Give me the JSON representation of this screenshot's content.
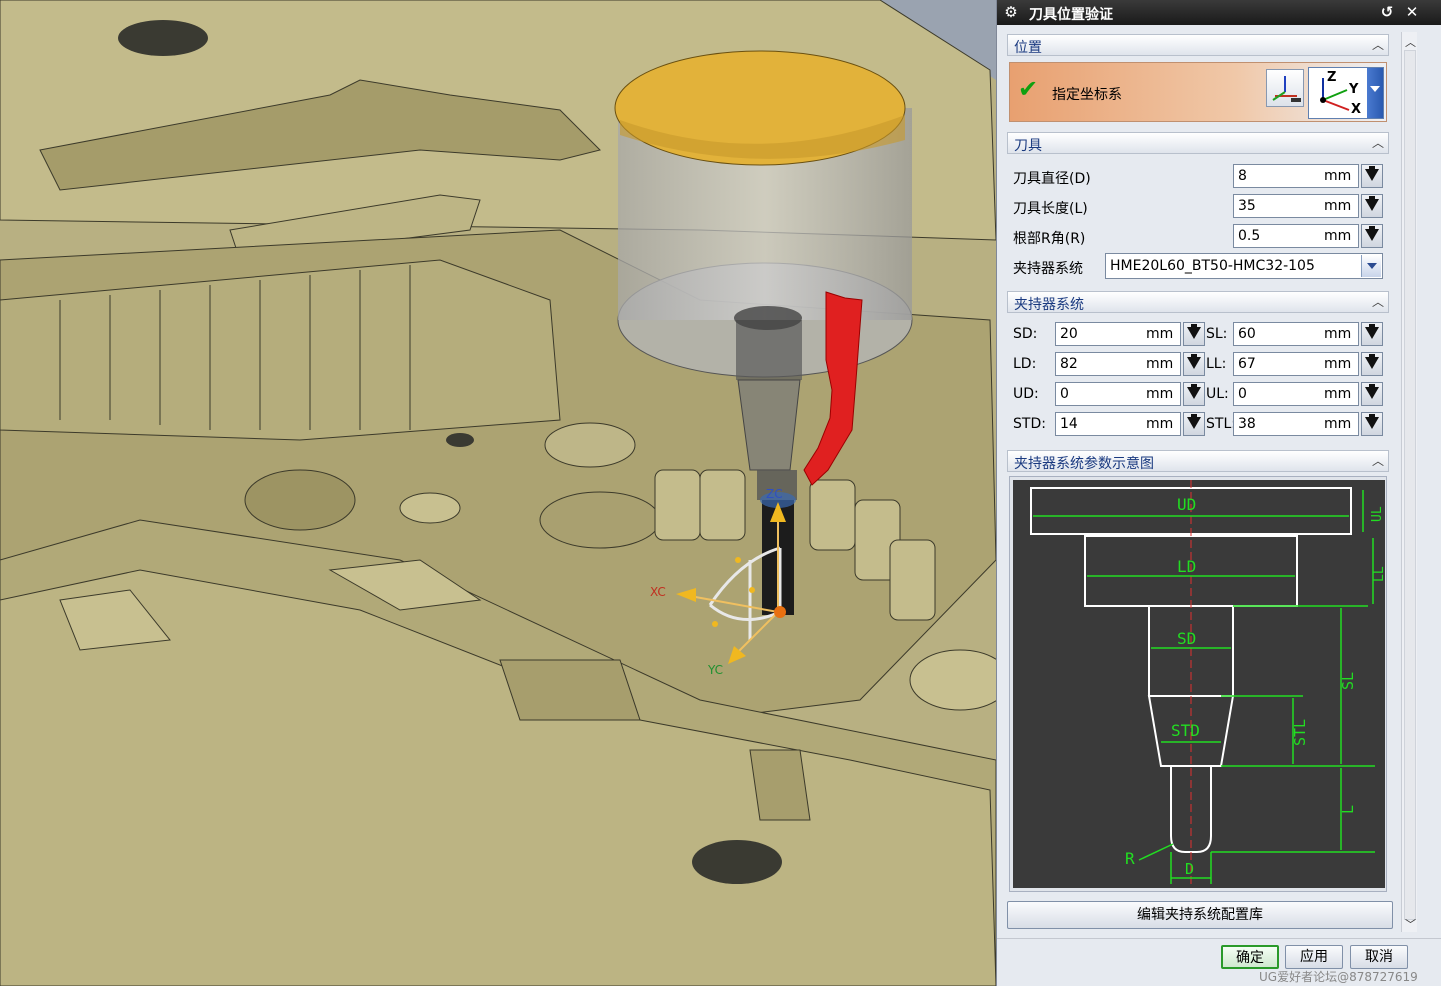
{
  "dialog": {
    "title": "刀具位置验证",
    "sections": {
      "position": {
        "label": "位置",
        "csys_label": "指定坐标系",
        "axes": {
          "z": "Z",
          "y": "Y",
          "x": "X"
        }
      },
      "tool": {
        "label": "刀具",
        "rows": [
          {
            "label": "刀具直径(D)",
            "value": "8",
            "unit": "mm"
          },
          {
            "label": "刀具长度(L)",
            "value": "35",
            "unit": "mm"
          },
          {
            "label": "根部R角(R)",
            "value": "0.5",
            "unit": "mm"
          }
        ],
        "holder_label": "夹持器系统",
        "holder_value": "HME20L60_BT50-HMC32-105"
      },
      "holder": {
        "label": "夹持器系统",
        "rows": [
          {
            "l_label": "SD:",
            "l_value": "20",
            "r_label": "SL:",
            "r_value": "60",
            "unit": "mm"
          },
          {
            "l_label": "LD:",
            "l_value": "82",
            "r_label": "LL:",
            "r_value": "67",
            "unit": "mm"
          },
          {
            "l_label": "UD:",
            "l_value": "0",
            "r_label": "UL:",
            "r_value": "0",
            "unit": "mm"
          },
          {
            "l_label": "STD:",
            "l_value": "14",
            "r_label": "STL:",
            "r_value": "38",
            "unit": "mm"
          }
        ]
      },
      "diagram": {
        "label": "夹持器系统参数示意图",
        "labels": {
          "ud": "UD",
          "ul": "UL",
          "ld": "LD",
          "ll": "LL",
          "sd": "SD",
          "sl": "SL",
          "std": "STD",
          "stl": "STL",
          "l": "L",
          "r": "R",
          "d": "D"
        }
      }
    },
    "edit_button": "编辑夹持系统配置库",
    "ok_button": "确定",
    "apply_button": "应用",
    "cancel_button": "取消"
  },
  "viewport": {
    "triad_labels": {
      "zc": "ZC",
      "xc": "XC",
      "yc": "YC"
    }
  },
  "watermark": "UG爱好者论坛@878727619",
  "colors": {
    "model": "#b9b183",
    "accent_green": "#22dd22",
    "tool_red": "#e02020",
    "titlebar": "#202020"
  }
}
